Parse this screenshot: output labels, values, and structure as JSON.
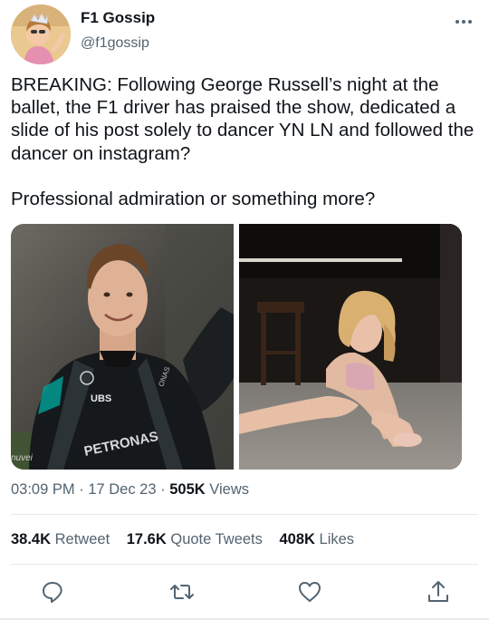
{
  "author": {
    "display_name": "F1 Gossip",
    "handle": "@f1gossip"
  },
  "tweet": {
    "text": "BREAKING: Following George Russell’s night at the ballet, the F1 driver has praised the show, dedicated a slide of his post solely to dancer YN LN and followed the dancer on instagram?",
    "question": "Professional admiration or something more?",
    "timestamp_time": "03:09 PM",
    "separator": "·",
    "timestamp_date": "17 Dec 23",
    "views_count": "505K",
    "views_label": "Views"
  },
  "media": {
    "left_photo_text": [
      "UBS",
      "PETRONAS",
      "ONAS"
    ],
    "right_photo_text": []
  },
  "stats": {
    "retweets_count": "38.4K",
    "retweets_label": "Retweet",
    "quotes_count": "17.6K",
    "quotes_label": "Quote Tweets",
    "likes_count": "408K",
    "likes_label": "Likes"
  },
  "icons": {
    "more": "more-dots-icon",
    "reply": "reply-icon",
    "retweet": "retweet-icon",
    "like": "heart-icon",
    "share": "share-icon"
  },
  "colors": {
    "text": "#0f1419",
    "secondary": "#536471",
    "divider": "#e7e9ea"
  }
}
